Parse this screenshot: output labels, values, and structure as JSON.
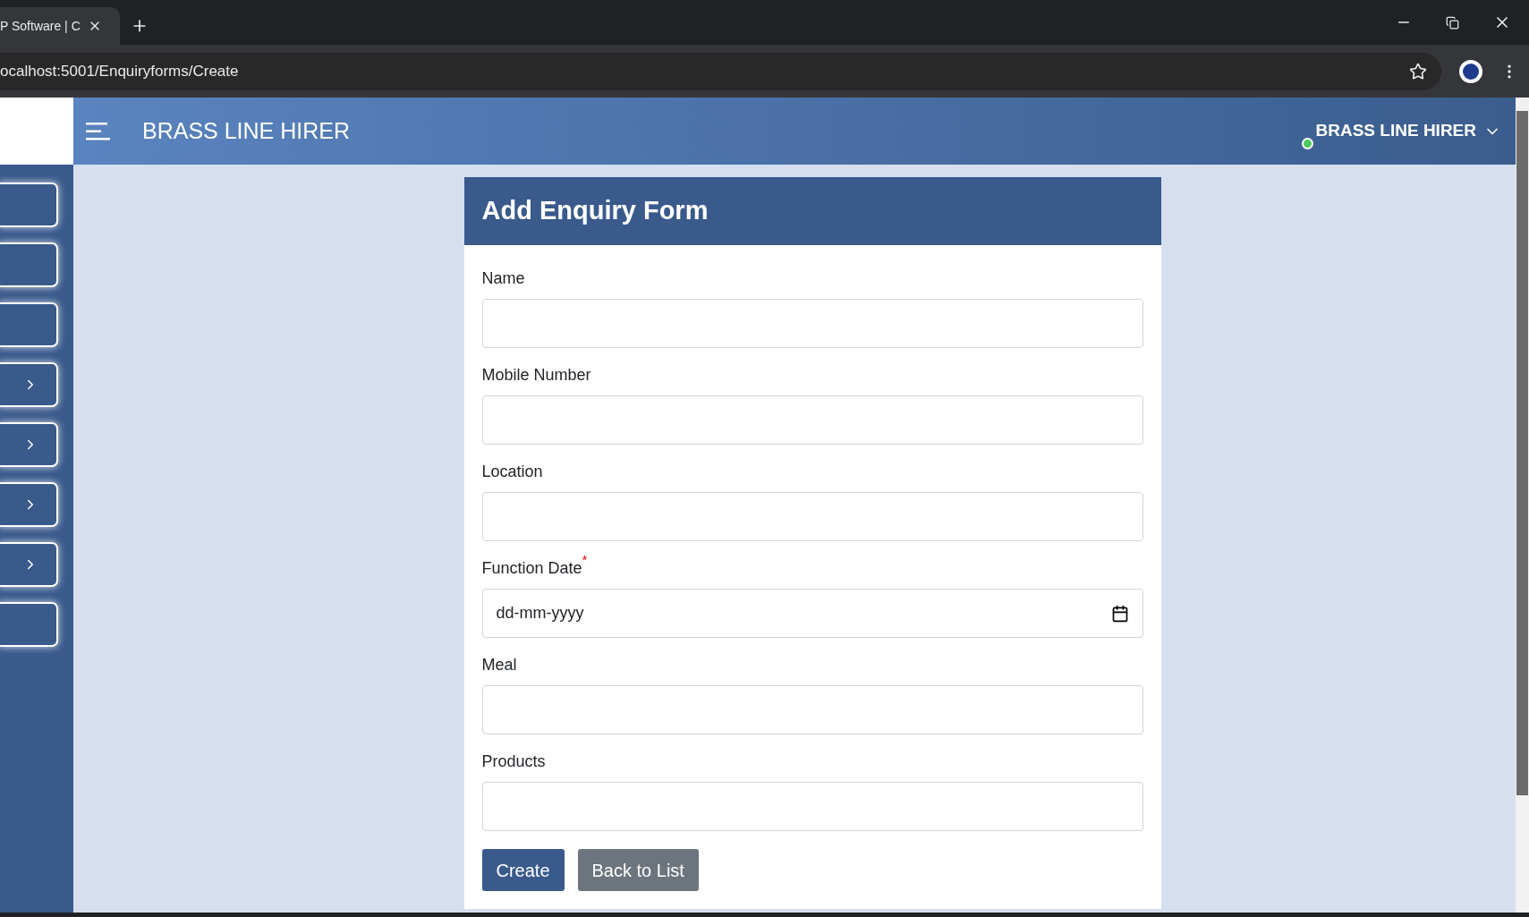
{
  "browser": {
    "tab_title": "P Software | C",
    "address": "ocalhost:5001/Enquiryforms/Create"
  },
  "header": {
    "title": "BRASS LINE HIRER",
    "user": "BRASS LINE HIRER",
    "online": true
  },
  "sidebar": {
    "items": [
      {
        "expandable": false
      },
      {
        "expandable": false
      },
      {
        "expandable": false
      },
      {
        "expandable": true
      },
      {
        "expandable": true
      },
      {
        "expandable": true
      },
      {
        "expandable": true
      },
      {
        "expandable": false
      }
    ]
  },
  "form": {
    "title": "Add Enquiry Form",
    "fields": [
      {
        "label": "Name",
        "kind": "text"
      },
      {
        "label": "Mobile Number",
        "kind": "text"
      },
      {
        "label": "Location",
        "kind": "text"
      },
      {
        "label": "Function Date",
        "kind": "date",
        "required_mark": "*",
        "placeholder": "dd-mm-yyyy"
      },
      {
        "label": "Meal",
        "kind": "text"
      },
      {
        "label": "Products",
        "kind": "text"
      }
    ],
    "buttons": [
      {
        "label": "Create",
        "kind": "primary"
      },
      {
        "label": "Back to List",
        "kind": "secondary"
      }
    ]
  }
}
